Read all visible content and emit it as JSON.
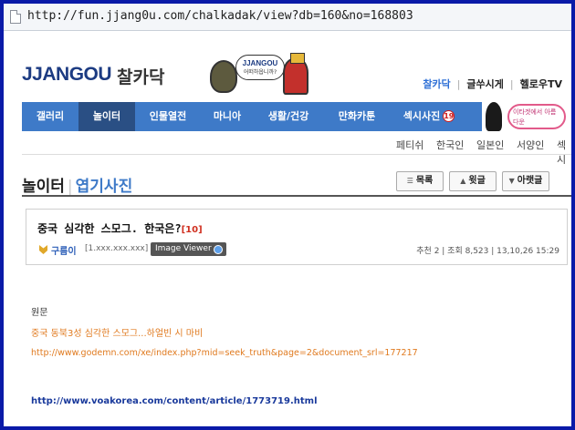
{
  "browser": {
    "url": "http://fun.jjang0u.com/chalkadak/view?db=160&no=168803"
  },
  "header": {
    "logo": "JJANGOU",
    "logo_sub": "찰카닥",
    "mascot_bubble_title": "JJANGOU",
    "mascot_bubble_sub": "어떠하옵니까?",
    "top_links": [
      "찰카닥",
      "글쑤시게",
      "헬로우TV"
    ]
  },
  "nav": {
    "items": [
      "갤러리",
      "놀이터",
      "인물열전",
      "마니아",
      "생활/건강",
      "만화카툰",
      "섹시사진"
    ],
    "active_index": 1,
    "adult_badge": "19",
    "promo_text": "이타겟에서 아름다운"
  },
  "subnav": {
    "items": [
      "페티쉬",
      "한국인",
      "일본인",
      "서양인",
      "섹시"
    ]
  },
  "board": {
    "title": "놀이터",
    "category": "엽기사진",
    "buttons": {
      "list": "목록",
      "prev": "윗글",
      "next": "아랫글"
    }
  },
  "post": {
    "title": "중국 심각한 스모그. 한국은?",
    "comment_count": "[10]",
    "author": "구름이",
    "author_ip": "[1.xxx.xxx.xxx]",
    "image_viewer": "Image Viewer",
    "stats": "추천 2 | 조회 8,523 | 13,10,26 15:29"
  },
  "content": {
    "line_original": "원문",
    "line_org_title": "중국 동북3성 심각한 스모그...하얼빈 시 마비",
    "line_url1": "http://www.godemn.com/xe/index.php?mid=seek_truth&page=2&document_srl=177217",
    "line_url2": "http://www.voakorea.com/content/article/1773719.html"
  },
  "colors": {
    "frame": "#0a1aa8",
    "nav": "#3e7ac8",
    "nav_active": "#2a4f84",
    "logo": "#1c3b82",
    "accent_link": "#e07a1f"
  }
}
